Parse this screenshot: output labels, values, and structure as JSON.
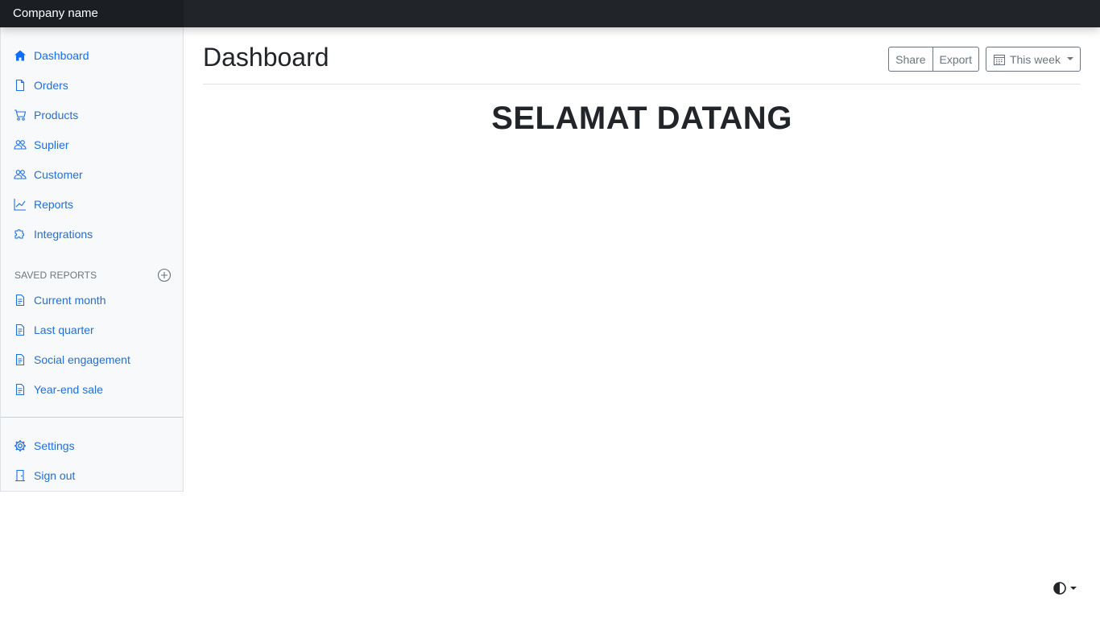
{
  "brand": "Company name",
  "sidebar": {
    "items": [
      {
        "label": "Dashboard",
        "icon": "house-icon"
      },
      {
        "label": "Orders",
        "icon": "file-icon"
      },
      {
        "label": "Products",
        "icon": "cart-icon"
      },
      {
        "label": "Suplier",
        "icon": "people-icon"
      },
      {
        "label": "Customer",
        "icon": "people-icon"
      },
      {
        "label": "Reports",
        "icon": "graph-icon"
      },
      {
        "label": "Integrations",
        "icon": "puzzle-icon"
      }
    ],
    "saved_heading": "SAVED REPORTS",
    "saved_reports": [
      {
        "label": "Current month",
        "icon": "file-text-icon"
      },
      {
        "label": "Last quarter",
        "icon": "file-text-icon"
      },
      {
        "label": "Social engagement",
        "icon": "file-text-icon"
      },
      {
        "label": "Year-end sale",
        "icon": "file-text-icon"
      }
    ],
    "footer": [
      {
        "label": "Settings",
        "icon": "gear-icon"
      },
      {
        "label": "Sign out",
        "icon": "door-icon"
      }
    ]
  },
  "main": {
    "title": "Dashboard",
    "toolbar": {
      "share": "Share",
      "export": "Export",
      "range": "This week"
    },
    "welcome": "SELAMAT DATANG"
  },
  "colors": {
    "accent": "#0d6efd",
    "topbar": "#212529",
    "sidebar_bg": "#f8f9fa"
  }
}
